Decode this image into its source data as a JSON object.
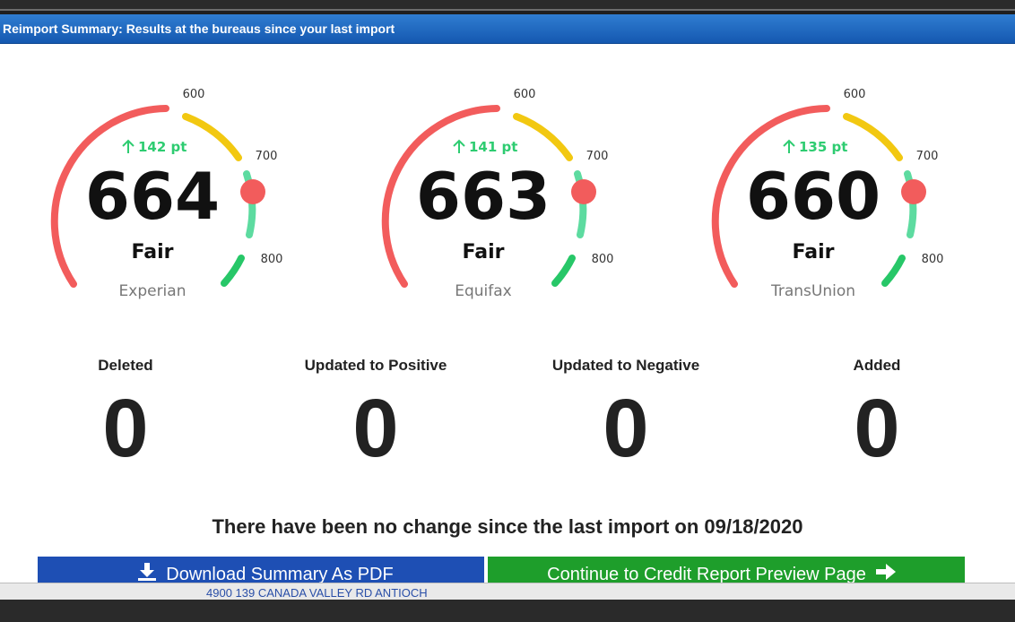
{
  "modal": {
    "title": "Reimport Summary: Results at the bureaus since your last import"
  },
  "gauge_scale": {
    "ticks": [
      "600",
      "700",
      "800"
    ]
  },
  "gauges": [
    {
      "bureau": "Experian",
      "score": "664",
      "delta": "142 pt",
      "rating": "Fair"
    },
    {
      "bureau": "Equifax",
      "score": "663",
      "delta": "141 pt",
      "rating": "Fair"
    },
    {
      "bureau": "TransUnion",
      "score": "660",
      "delta": "135 pt",
      "rating": "Fair"
    }
  ],
  "stats": [
    {
      "label": "Deleted",
      "value": "0"
    },
    {
      "label": "Updated to Positive",
      "value": "0"
    },
    {
      "label": "Updated to Negative",
      "value": "0"
    },
    {
      "label": "Added",
      "value": "0"
    }
  ],
  "message": "There have been no change since the last import on 09/18/2020",
  "buttons": {
    "pdf": "Download Summary As PDF",
    "continue": "Continue to Credit Report Preview Page"
  },
  "background": {
    "address": "4900 139 CANADA VALLEY RD ANTIOCH"
  },
  "colors": {
    "header_blue": "#1f66c2",
    "poor": "#f25c5c",
    "fair": "#f2c811",
    "good": "#5ddba0",
    "excellent": "#27c768",
    "delta": "#2ecc71",
    "pdf_button": "#1e4fb4",
    "continue_button": "#1e9e2b"
  },
  "icons": {
    "delta": "arrow-up-icon",
    "pdf": "download-icon",
    "continue": "arrow-right-icon"
  }
}
